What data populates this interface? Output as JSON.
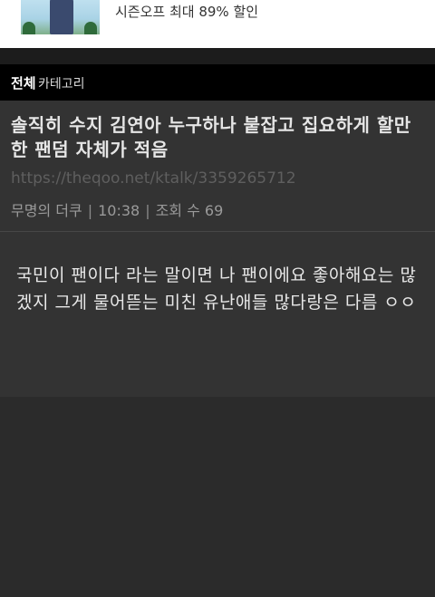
{
  "ad": {
    "text": "시즌오프 최대 89% 할인"
  },
  "category_bar": {
    "all_label": "전체",
    "category_label": "카테고리"
  },
  "post": {
    "title": "솔직히 수지 김연아 누구하나 붙잡고 집요하게 할만한 팬덤 자체가 적음",
    "url": "https://theqoo.net/ktalk/3359265712",
    "author": "무명의 더쿠",
    "separator": "|",
    "time": "10:38",
    "views": "조회 수 69",
    "content": "국민이 팬이다 라는 말이면 나 팬이에요 좋아해요는 많겠지 그게 물어뜯는 미친 유난애들 많다랑은 다름 ㅇㅇ"
  },
  "colors": {
    "background": "#2b2b2b",
    "card": "#333333",
    "category_bar": "#000000",
    "title_text": "#e6e6e6",
    "url_text": "#5f5f5f",
    "meta_text": "#9a9a9a"
  }
}
